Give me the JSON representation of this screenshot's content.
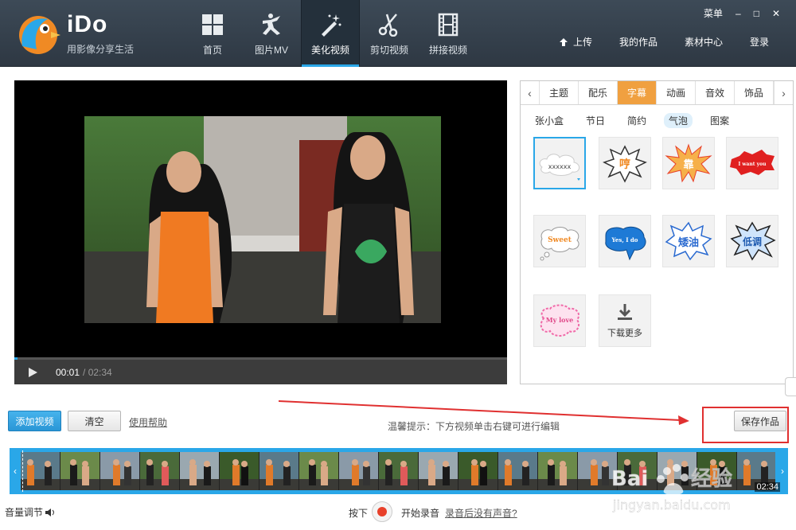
{
  "app": {
    "brand": "iDo",
    "slogan": "用影像分享生活"
  },
  "nav": [
    {
      "label": "首页",
      "icon": "home-grid-icon"
    },
    {
      "label": "图片MV",
      "icon": "dancer-icon"
    },
    {
      "label": "美化视频",
      "icon": "magic-wand-icon",
      "active": true
    },
    {
      "label": "剪切视频",
      "icon": "scissors-icon"
    },
    {
      "label": "拼接视频",
      "icon": "film-strip-icon"
    }
  ],
  "window": {
    "menu_label": "菜单",
    "minimize": "–",
    "maximize": "□",
    "close": "✕"
  },
  "top_links": {
    "upload": "上传",
    "my_works": "我的作品",
    "materials": "素材中心",
    "login": "登录"
  },
  "player": {
    "current_time": "00:01",
    "total_time": "/ 02:34",
    "progress": 0.007
  },
  "panel": {
    "tabs": [
      "主题",
      "配乐",
      "字幕",
      "动画",
      "音效",
      "饰品"
    ],
    "active_tab": 2,
    "subtabs": [
      "张小盒",
      "节日",
      "简约",
      "气泡",
      "图案"
    ],
    "active_subtab": 3,
    "stickers": [
      {
        "text": "xxxxxx",
        "style": "cloud",
        "selected": true
      },
      {
        "text": "哼",
        "style": "burst-orange"
      },
      {
        "text": "靠",
        "style": "explosion"
      },
      {
        "text": "I want you",
        "style": "red-splash"
      },
      {
        "text": "Sweet",
        "style": "thought"
      },
      {
        "text": "Yes, I do",
        "style": "blue-splash"
      },
      {
        "text": "矮油",
        "style": "spiky-blue"
      },
      {
        "text": "低调",
        "style": "jagged-blue"
      },
      {
        "text": "My love",
        "style": "pink-flower"
      }
    ],
    "download_more": "下载更多"
  },
  "toolbar": {
    "add_video": "添加视频",
    "clear": "清空",
    "help": "使用帮助",
    "tip": "温馨提示：下方视频单击右键可进行编辑",
    "save": "保存作品"
  },
  "timeline": {
    "duration": "02:34"
  },
  "footer": {
    "volume": "音量调节",
    "press": "按下",
    "start_record": "开始录音",
    "no_sound_help": "录音后没有声音?"
  },
  "colors": {
    "accent": "#2aa7e8",
    "tab_active": "#f0a040",
    "highlight": "#e03030",
    "record": "#e8402a"
  }
}
